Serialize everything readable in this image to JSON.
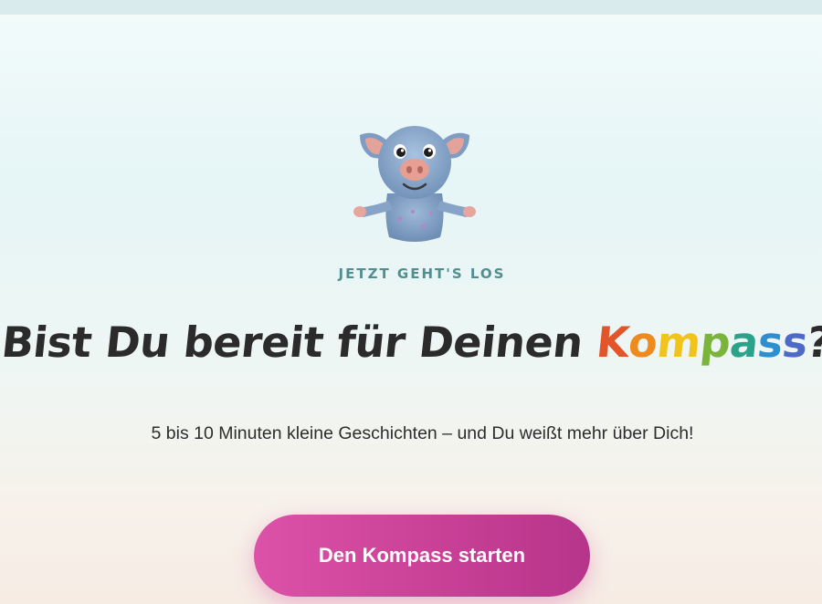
{
  "hero": {
    "eyebrow": "JETZT GEHT'S LOS",
    "headline_prefix": "Bist Du bereit für Deinen ",
    "headline_highlight": "Kompass",
    "headline_suffix": "?",
    "subtext": "5 bis 10 Minuten kleine Geschichten – und Du weißt mehr über Dich!",
    "cta_label": "Den Kompass starten"
  },
  "mascot": {
    "icon": "pig-mascot"
  },
  "colors": {
    "eyebrow": "#4f8f8f",
    "headline": "#2b2b2b",
    "cta_start": "#dc52a8",
    "cta_end": "#b6358a",
    "rainbow": [
      "#e2552b",
      "#ef8a1f",
      "#f2c31b",
      "#7bb43a",
      "#2aa38a",
      "#2d8fd1",
      "#4f69c6"
    ]
  }
}
